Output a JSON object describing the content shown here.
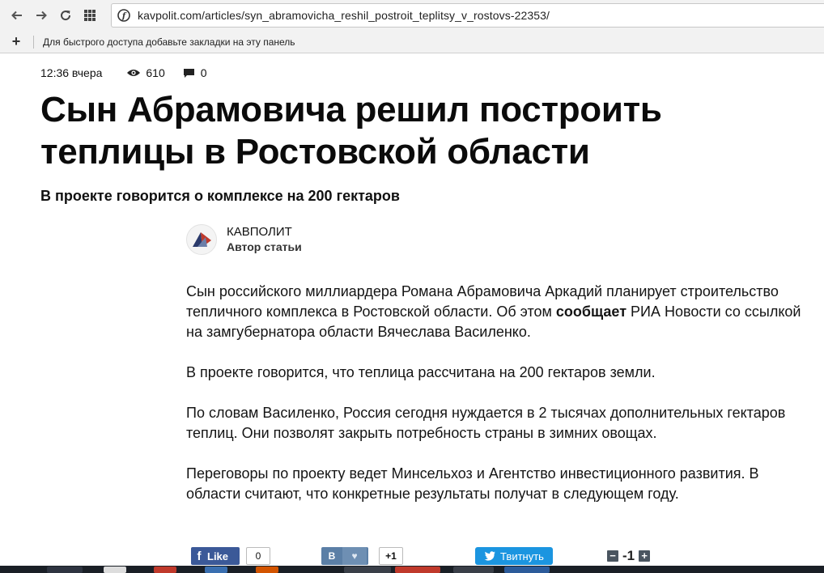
{
  "browser": {
    "url": "kavpolit.com/articles/syn_abramovicha_reshil_postroit_teplitsy_v_rostovs-22353/",
    "bookmarks_hint": "Для быстрого доступа добавьте закладки на эту панель",
    "icons": [
      "back-arrow-icon",
      "forward-arrow-icon",
      "reload-icon",
      "apps-grid-icon",
      "site-info-icon",
      "add-bookmark-icon"
    ]
  },
  "article": {
    "time": "12:36 вчера",
    "views": "610",
    "comments": "0",
    "title": "Сын Абрамовича решил построить теплицы в Ростовской области",
    "subtitle": "В проекте говорится о комплексе на 200 гектаров",
    "author": {
      "name": "КАВПОЛИТ",
      "role": "Автор статьи"
    },
    "paragraphs": {
      "p1_before": "Сын российского миллиардера Романа Абрамовича Аркадий планирует строительство тепличного комплекса в Ростовской области. Об этом ",
      "p1_link": "сообщает",
      "p1_after": " РИА Новости со ссылкой на замгубернатора области Вячеслава Василенко.",
      "p2": "В проекте говорится, что теплица рассчитана на 200 гектаров земли.",
      "p3": "По словам Василенко, Россия сегодня нуждается в 2 тысячах дополнительных гектаров теплиц. Они позволят закрыть потребность страны в зимних овощах.",
      "p4": "Переговоры по проекту ведет Минсельхоз и Агентство инвестиционного развития. В области считают, что конкретные результаты получат в следующем году."
    }
  },
  "share": {
    "fb_label": "Like",
    "fb_count": "0",
    "vk_label": "В",
    "vk_count": "+1",
    "twitter_label": "Твитнуть",
    "vote_minus": "−",
    "vote_value": "-1",
    "vote_plus": "+"
  },
  "colors": {
    "facebook": "#3b5998",
    "vk": "#5b7fa6",
    "twitter": "#1b95e0",
    "toolbar_bg": "#f2f2f2"
  }
}
